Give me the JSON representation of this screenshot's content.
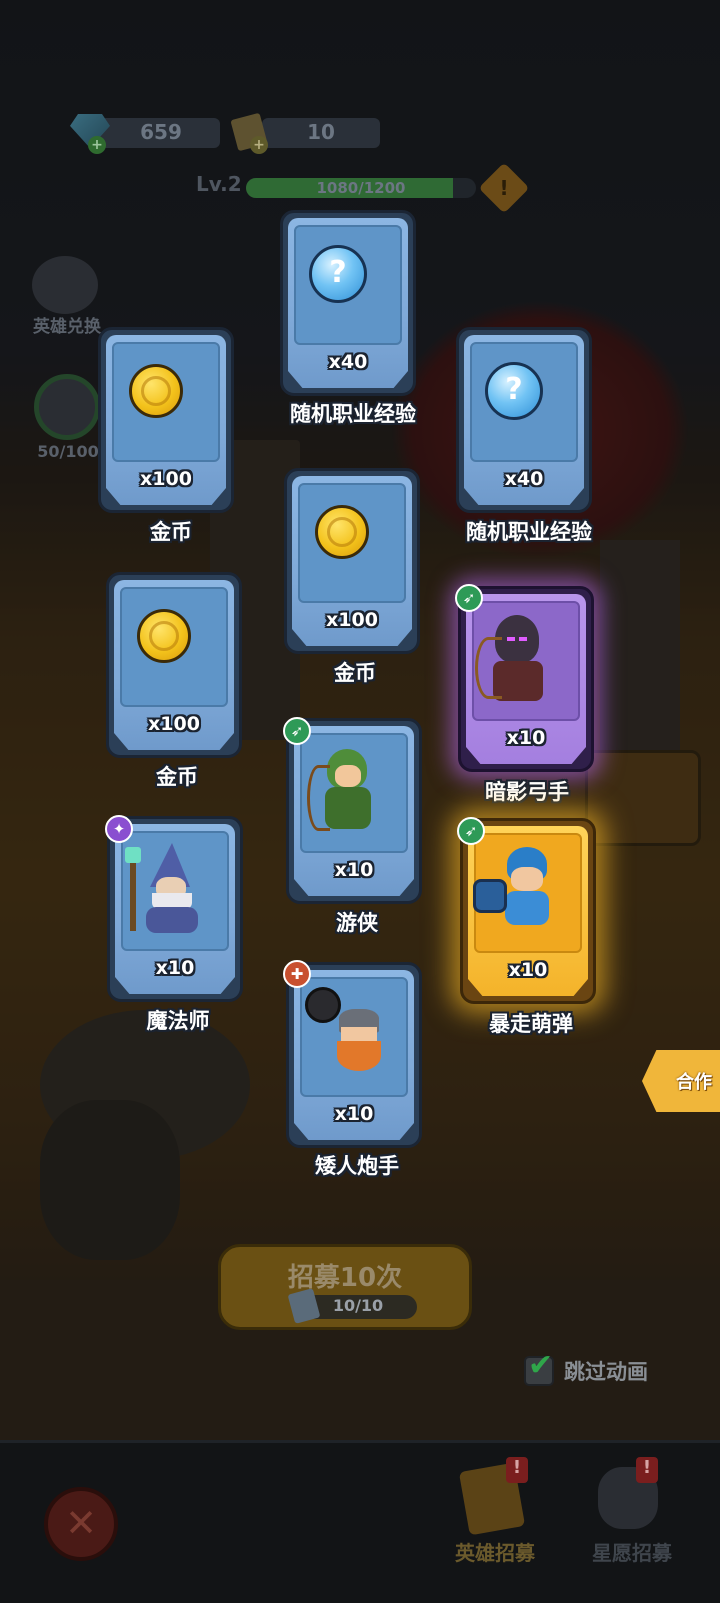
{
  "top": {
    "gems": "659",
    "tickets": "10",
    "level": "Lv.2",
    "xp": "1080/1200",
    "xp_progress": 0.9
  },
  "left_side": {
    "hero_exchange": "英雄兑换",
    "progress": "50/100"
  },
  "rewards": [
    {
      "qty": "x40",
      "label": "随机职业经验",
      "kind": "question"
    },
    {
      "qty": "x100",
      "label": "金币",
      "kind": "coin"
    },
    {
      "qty": "x40",
      "label": "随机职业经验",
      "kind": "question"
    },
    {
      "qty": "x100",
      "label": "金币",
      "kind": "coin"
    },
    {
      "qty": "x100",
      "label": "金币",
      "kind": "coin"
    },
    {
      "qty": "x10",
      "label": "暗影弓手",
      "kind": "hero",
      "rarity": "purple"
    },
    {
      "qty": "x10",
      "label": "游侠",
      "kind": "hero"
    },
    {
      "qty": "x10",
      "label": "魔法师",
      "kind": "hero"
    },
    {
      "qty": "x10",
      "label": "暴走萌弹",
      "kind": "hero",
      "rarity": "gold"
    },
    {
      "qty": "x10",
      "label": "矮人炮手",
      "kind": "hero"
    }
  ],
  "recruit": {
    "button": "招募10次",
    "count": "10/10"
  },
  "skip_animation": "跳过动画",
  "side_tab": "合作",
  "bottom_nav": {
    "hero_recruit": "英雄招募",
    "wish_recruit": "星愿招募"
  },
  "colors": {
    "card_blue": "#7fa9d8",
    "card_purple": "#a47fdf",
    "card_gold": "#f4b32a",
    "xp_bar": "#3fae4a"
  }
}
